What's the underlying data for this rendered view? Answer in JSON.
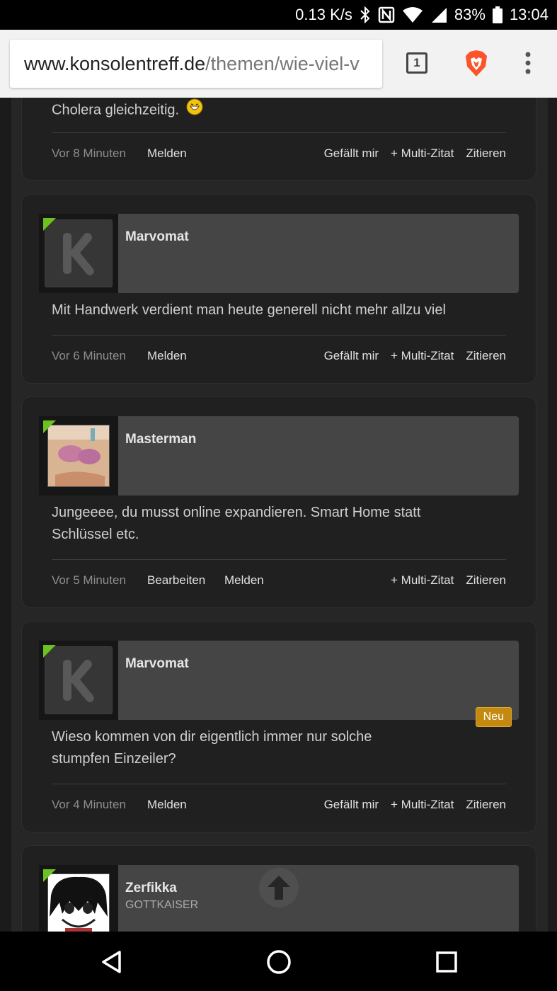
{
  "status_bar": {
    "speed": "0.13 K/s",
    "battery": "83%",
    "time": "13:04",
    "icons": [
      "bluetooth-icon",
      "nfc-icon",
      "wifi-icon",
      "signal-icon",
      "battery-icon"
    ]
  },
  "browser": {
    "url_host": "www.konsolentreff.de",
    "url_path": "/themen/wie-viel-v",
    "tab_count": "1"
  },
  "top_partial": {
    "text": "Cholera gleichzeitig.",
    "time": "Vor 8 Minuten",
    "report": "Melden",
    "like": "Gefällt mir",
    "multiquote": "+ Multi-Zitat",
    "quote": "Zitieren"
  },
  "posts": [
    {
      "username": "Marvomat",
      "avatar_letter": "K",
      "message_lines": [
        "Mit Handwerk verdient man heute generell nicht mehr allzu viel"
      ],
      "time": "Vor 6 Minuten",
      "report": "Melden",
      "like": "Gefällt mir",
      "multiquote": "+ Multi-Zitat",
      "quote": "Zitieren"
    },
    {
      "username": "Masterman",
      "message_lines": [
        "Jungeeee, du musst online expandieren. Smart Home statt",
        "Schlüssel etc."
      ],
      "time": "Vor 5 Minuten",
      "edit": "Bearbeiten",
      "report": "Melden",
      "multiquote": "+ Multi-Zitat",
      "quote": "Zitieren"
    },
    {
      "username": "Marvomat",
      "avatar_letter": "K",
      "badge": "Neu",
      "message_lines": [
        "Wieso kommen von dir eigentlich immer nur solche",
        "stumpfen Einzeiler?"
      ],
      "time": "Vor 4 Minuten",
      "report": "Melden",
      "like": "Gefällt mir",
      "multiquote": "+ Multi-Zitat",
      "quote": "Zitieren"
    },
    {
      "username": "Zerfikka",
      "usertitle": "GOTTKAISER"
    }
  ],
  "colors": {
    "accent_green": "#6ec21e",
    "badge_orange": "#c48a10",
    "brave_orange": "#fb542b"
  }
}
